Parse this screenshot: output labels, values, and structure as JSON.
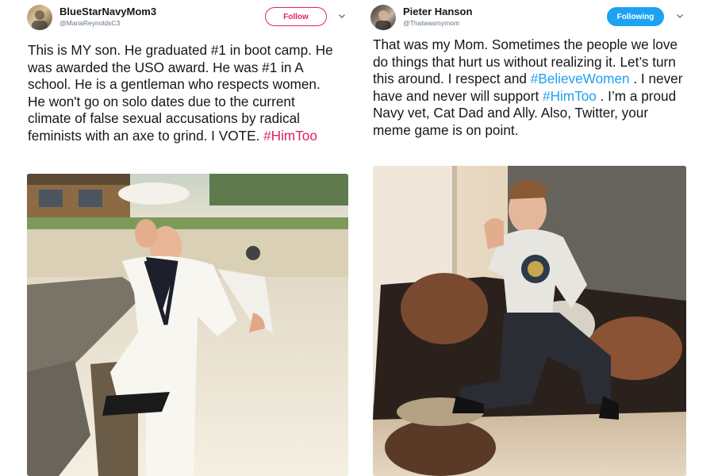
{
  "tweets": [
    {
      "display_name": "BlueStarNavyMom3",
      "handle": "@MariaReynoldsC3",
      "button_label": "Follow",
      "text": "This is MY son. He graduated #1 in boot camp. He was awarded the USO award. He was #1 in A school. He is a gentleman who respects women. He won't go on solo dates due to the current climate of false sexual accusations by radical feminists with an axe to grind. I VOTE. ",
      "hashtag": "#HimToo"
    },
    {
      "display_name": "Pieter Hanson",
      "handle": "@Thatwasmymom",
      "button_label": "Following",
      "text_1": "That was my Mom. Sometimes the people we love do things that hurt us without realizing it. Let’s turn this around. I respect and ",
      "hashtag_1": "#BelieveWomen",
      "text_2": " . I never have and never will support  ",
      "hashtag_2": "#HimToo",
      "text_3": " . I’m a proud Navy vet, Cat Dad and Ally. Also, Twitter, your meme game is on point."
    }
  ],
  "colors": {
    "follow_accent": "#e0245e",
    "following_bg": "#1da1f2",
    "hashtag_left": "#e0245e",
    "hashtag_right": "#1da1f2",
    "handle_gray": "#657786"
  },
  "icons": [
    "chevron-down-icon",
    "chevron-down-icon"
  ]
}
